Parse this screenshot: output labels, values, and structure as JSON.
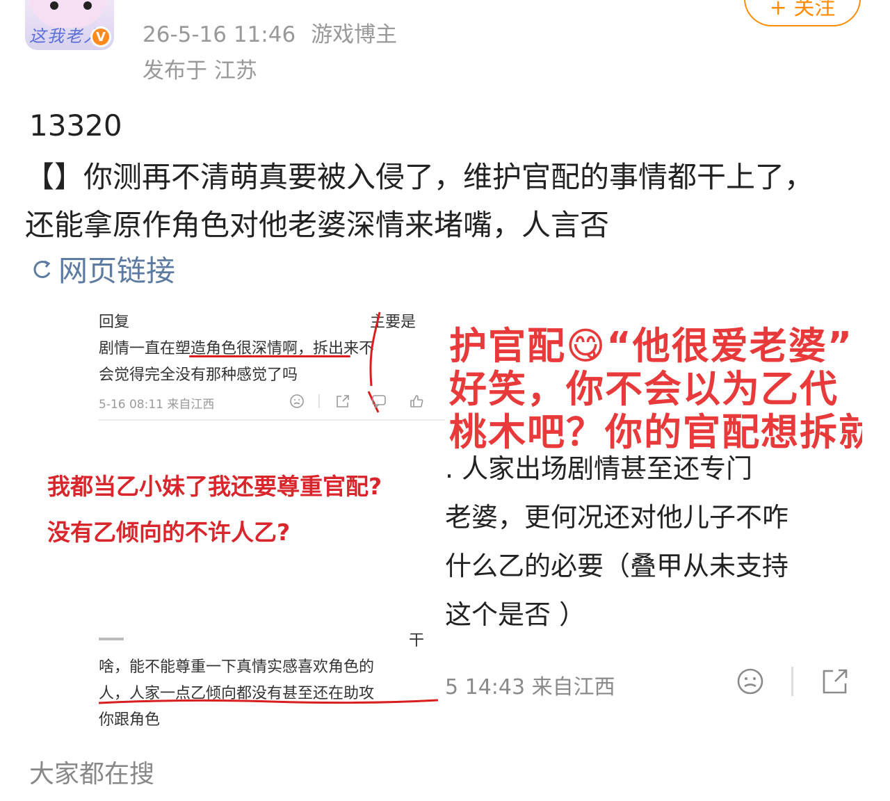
{
  "header": {
    "avatar_text": "这我老人",
    "verified_badge": "V",
    "timestamp": "26-5-16 11:46",
    "user_role": "游戏博主",
    "location": "发布于 江苏",
    "follow_label": "+ 关注"
  },
  "post": {
    "number": "13320",
    "body": "【】你测再不清萌真要被入侵了，维护官配的事情都干上了，还能拿原作角色对他老婆深情来堵嘴，人言否",
    "link_label": "网页链接",
    "link_icon": "link-icon"
  },
  "image_left": {
    "comment1_line1_start": "回复",
    "comment1_line1_end": "主要是",
    "comment1_line2": "剧情一直在塑造角色很深情啊，拆出来不",
    "comment1_line3": "会觉得完全没有那种感觉了吗",
    "comment1_meta": "5-16 08:11  来自江西",
    "caption_line1": "我都当乙小妹了我还要尊重官配?",
    "caption_line2": "没有乙倾向的不许人乙?",
    "comment2_line1_end": "干",
    "comment2_line2": "啥，能不能尊重一下真情实感喜欢角色的",
    "comment2_line3": "人，人家一点乙倾向都没有甚至还在助攻",
    "comment2_line4": "你跟角色",
    "icons": [
      "dislike-icon",
      "share-icon",
      "comment-icon",
      "like-icon"
    ]
  },
  "image_right": {
    "red_line1": "护官配😋“他很爱老婆”",
    "red_line2": "好笑，你不会以为乙代",
    "red_line3": "桃木吧？你的官配想拆就",
    "black_line1": ". 人家出场剧情甚至还专门",
    "black_line2": "老婆，更何况还对他儿子不咋",
    "black_line3": "什么乙的必要（叠甲从未支持",
    "black_line4": "这个是否            ）",
    "meta": "5 14:43  来自江西",
    "icons": [
      "dislike-icon",
      "share-icon"
    ]
  },
  "search_section": {
    "title": "大家都在搜"
  }
}
